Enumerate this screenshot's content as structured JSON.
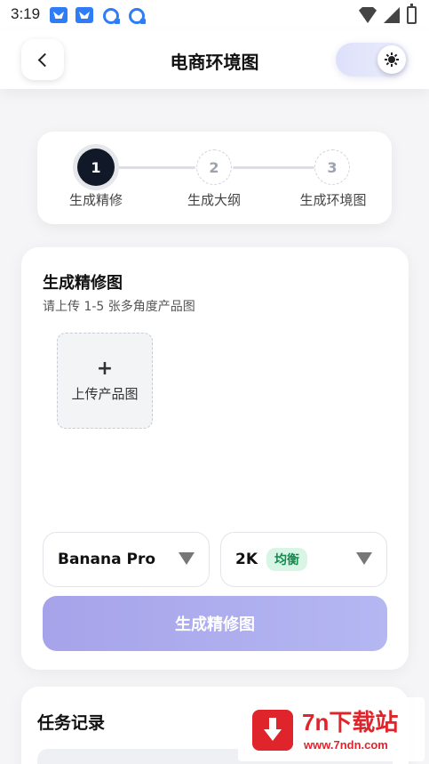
{
  "status_bar": {
    "time": "3:19"
  },
  "header": {
    "title": "电商环境图"
  },
  "stepper": {
    "steps": [
      {
        "number": "1",
        "label": "生成精修"
      },
      {
        "number": "2",
        "label": "生成大纲"
      },
      {
        "number": "3",
        "label": "生成环境图"
      }
    ],
    "active_step": 1
  },
  "refine": {
    "title": "生成精修图",
    "hint": "请上传 1-5 张多角度产品图",
    "upload_plus": "+",
    "upload_label": "上传产品图",
    "model_select_value": "Banana Pro",
    "resolution_select_value": "2K",
    "resolution_badge": "均衡",
    "generate_label": "生成精修图"
  },
  "tasks": {
    "title": "任务记录"
  },
  "watermark": {
    "name": "7n下载站",
    "url": "www.7ndn.com"
  },
  "colors": {
    "active_step": "#111827",
    "primary_button": "#a7a3ea",
    "badge_bg": "#d9f5e6",
    "badge_text": "#128a4c",
    "watermark_red": "#e0242b"
  }
}
